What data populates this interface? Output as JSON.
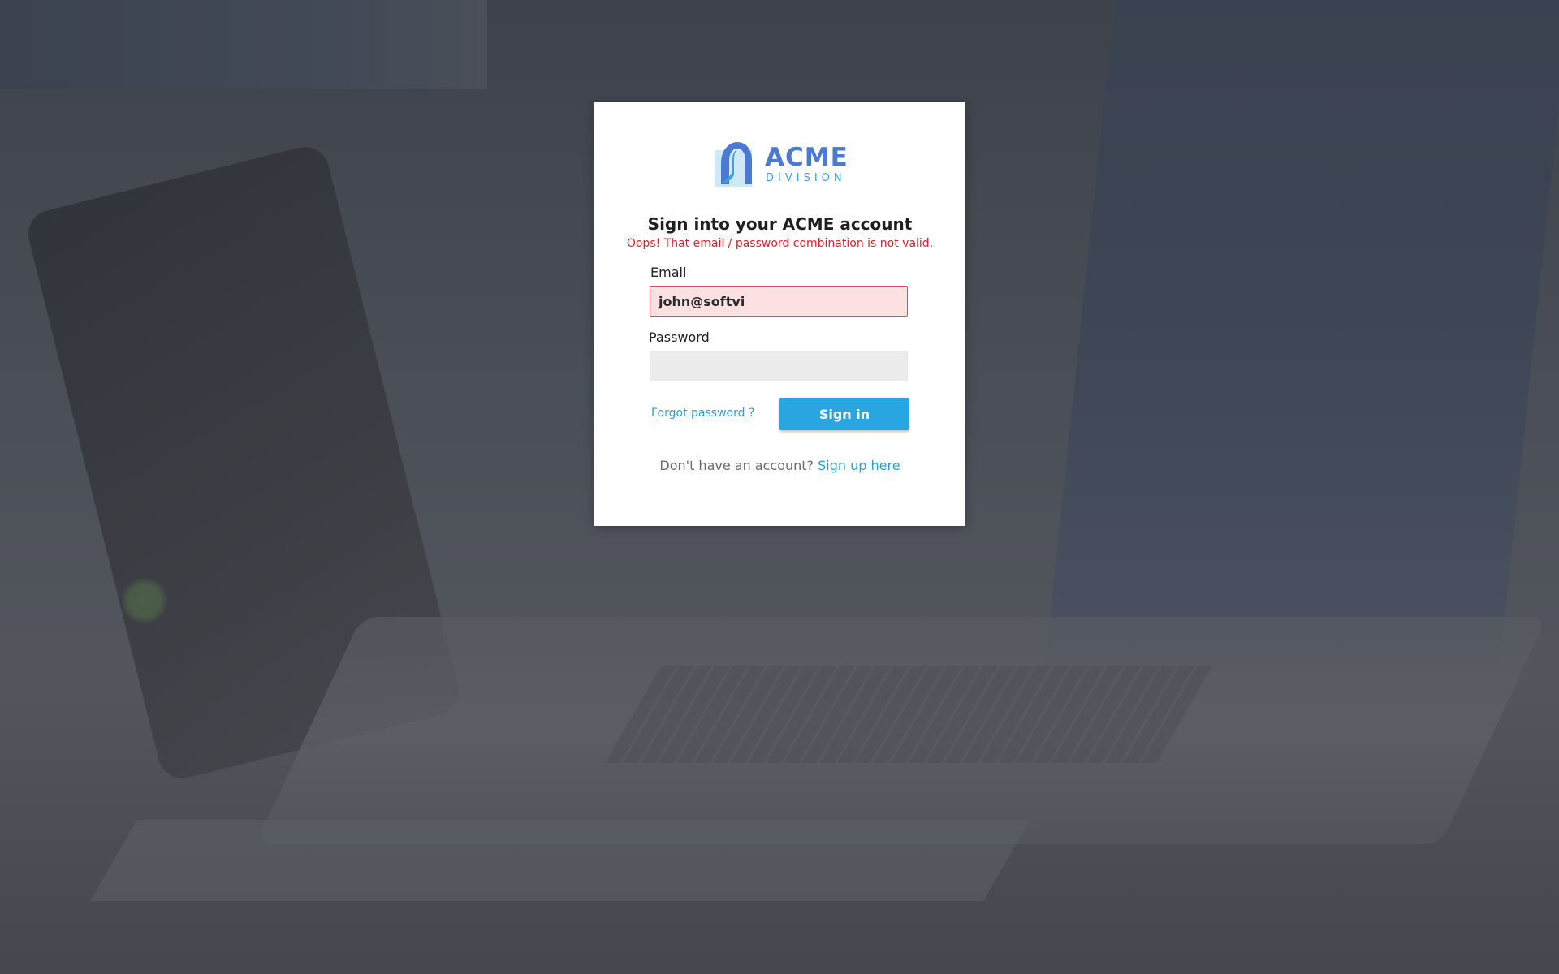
{
  "logo": {
    "wordmark": "ACME",
    "subtitle": "DIVISION",
    "colors": {
      "primary": "#4a7ad4",
      "secondary": "#3aa3de",
      "light": "#cfe8f6"
    }
  },
  "form": {
    "title": "Sign into your ACME account",
    "error_message": "Oops! That email / password combination is not valid.",
    "email_label": "Email",
    "email_value": "john@softvi",
    "password_label": "Password",
    "password_value": "",
    "forgot_label": "Forgot password ?",
    "signin_label": "Sign in",
    "signup_prompt": "Don't have an account?",
    "signup_link": "Sign up here"
  },
  "colors": {
    "accent": "#29a6e1",
    "error": "#e11d2a",
    "error_field_bg": "#fde0e2"
  }
}
